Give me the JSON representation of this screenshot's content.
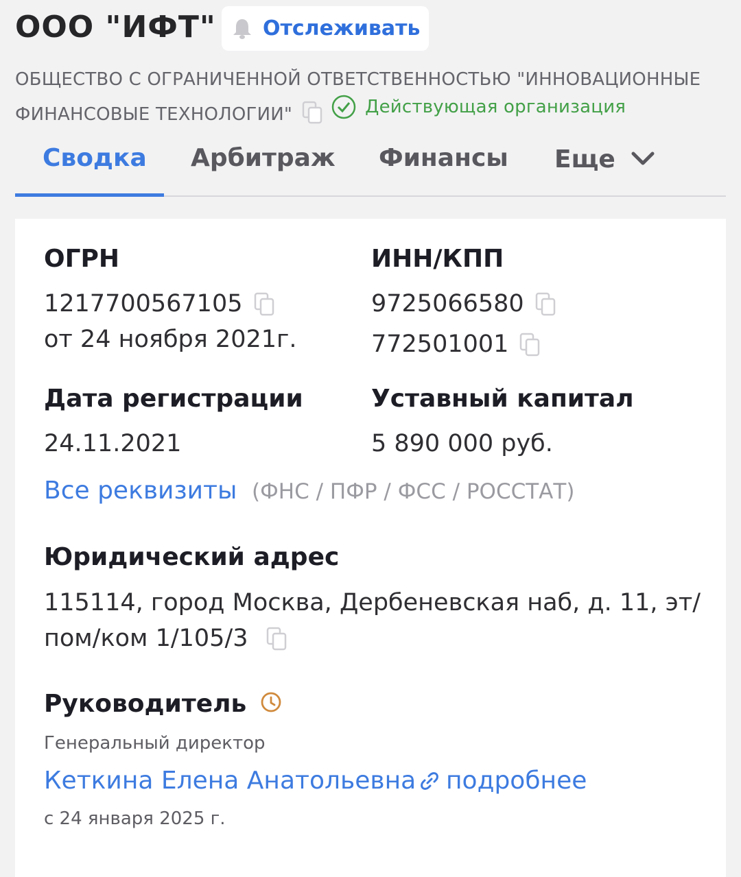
{
  "header": {
    "company_short": "ООО \"ИФТ\"",
    "track_label": "Отслеживать",
    "full_name": "ОБЩЕСТВО С ОГРАНИЧЕННОЙ ОТВЕТСТВЕННОСТЬЮ \"ИННОВАЦИОННЫЕ ФИНАНСОВЫЕ ТЕХНОЛОГИИ\"",
    "status": "Действующая организация"
  },
  "tabs": [
    {
      "label": "Сводка",
      "active": true
    },
    {
      "label": "Арбитраж"
    },
    {
      "label": "Финансы"
    },
    {
      "label": "Еще"
    }
  ],
  "card": {
    "ogrn": {
      "label": "ОГРН",
      "value": "1217700567105",
      "date": "от 24 ноября 2021г."
    },
    "inn_kpp": {
      "label": "ИНН/КПП",
      "inn": "9725066580",
      "kpp": "772501001"
    },
    "reg_date": {
      "label": "Дата регистрации",
      "value": "24.11.2021"
    },
    "capital": {
      "label": "Уставный капитал",
      "value": "5 890 000 руб."
    },
    "requisites": {
      "link": "Все реквизиты",
      "sources": "(ФНС / ПФР / ФСС / РОССТАТ)"
    },
    "address": {
      "label": "Юридический адрес",
      "line1": "115114, город Москва, Дербеневская наб, д. 11, эт/",
      "line2": "пом/ком 1/105/3"
    },
    "head": {
      "label": "Руководитель",
      "position": "Генеральный директор",
      "name": "Кеткина Елена Анатольевна",
      "more": "подробнее",
      "since": "с 24 января 2025 г."
    }
  },
  "colors": {
    "accent": "#3d7be0",
    "status_green": "#43a047",
    "history_icon": "#d08a3c"
  }
}
